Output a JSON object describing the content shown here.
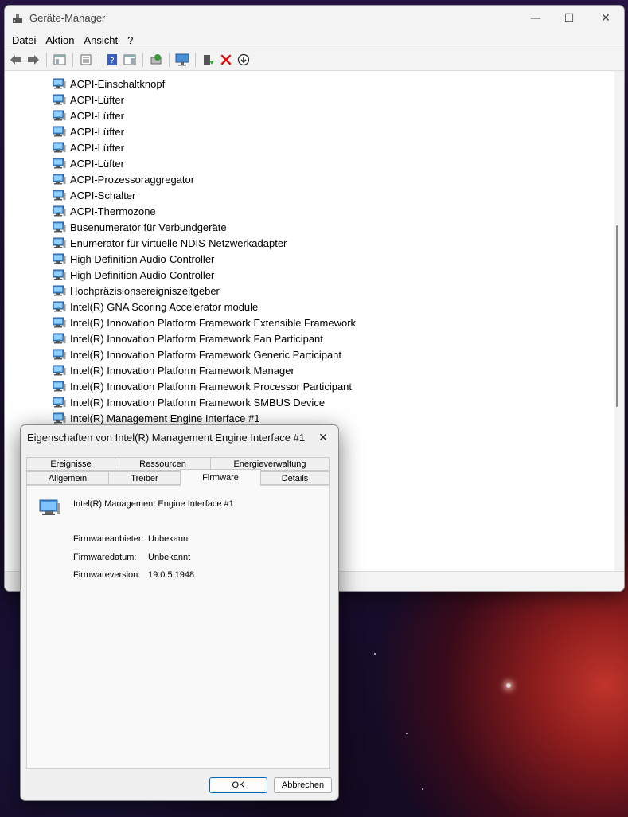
{
  "window": {
    "title": "Geräte-Manager",
    "minimize_glyph": "—",
    "maximize_glyph": "☐",
    "close_glyph": "✕"
  },
  "menu": [
    "Datei",
    "Aktion",
    "Ansicht",
    "?"
  ],
  "toolbar": [
    "back-icon",
    "forward-icon",
    "console-tree-icon",
    "properties-icon",
    "help-icon",
    "action-pane-icon",
    "update-driver-icon",
    "scan-hardware-icon",
    "enable-device-icon",
    "uninstall-icon",
    "disable-device-icon"
  ],
  "tree": {
    "items": [
      "ACPI-Einschaltknopf",
      "ACPI-Lüfter",
      "ACPI-Lüfter",
      "ACPI-Lüfter",
      "ACPI-Lüfter",
      "ACPI-Lüfter",
      "ACPI-Prozessoraggregator",
      "ACPI-Schalter",
      "ACPI-Thermozone",
      "Busenumerator für Verbundgeräte",
      "Enumerator für virtuelle NDIS-Netzwerkadapter",
      "High Definition Audio-Controller",
      "High Definition Audio-Controller",
      "Hochpräzisionsereigniszeitgeber",
      "Intel(R) GNA Scoring Accelerator module",
      "Intel(R) Innovation Platform Framework Extensible Framework",
      "Intel(R) Innovation Platform Framework Fan Participant",
      "Intel(R) Innovation Platform Framework Generic Participant",
      "Intel(R) Innovation Platform Framework Manager",
      "Intel(R) Innovation Platform Framework Processor Participant",
      "Intel(R) Innovation Platform Framework SMBUS Device",
      "Intel(R) Management Engine Interface #1"
    ]
  },
  "dialog": {
    "title": "Eigenschaften von Intel(R) Management Engine Interface #1",
    "close_glyph": "✕",
    "tabs_row1": [
      "Ereignisse",
      "Ressourcen",
      "Energieverwaltung"
    ],
    "tabs_row2": [
      "Allgemein",
      "Treiber",
      "Firmware",
      "Details"
    ],
    "active_tab": "Firmware",
    "device_name": "Intel(R) Management Engine Interface #1",
    "properties": [
      {
        "label": "Firmwareanbieter:",
        "value": "Unbekannt"
      },
      {
        "label": "Firmwaredatum:",
        "value": "Unbekannt"
      },
      {
        "label": "Firmwareversion:",
        "value": "19.0.5.1948"
      }
    ],
    "ok_label": "OK",
    "cancel_label": "Abbrechen"
  }
}
